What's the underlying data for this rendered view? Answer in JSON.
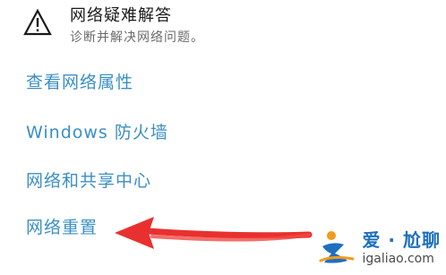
{
  "troubleshoot": {
    "title": "网络疑难解答",
    "subtitle": "诊断并解决网络问题。",
    "icon": "warning-icon"
  },
  "links": {
    "properties": "查看网络属性",
    "firewall": "Windows 防火墙",
    "sharing_center": "网络和共享中心",
    "reset": "网络重置"
  },
  "watermark": {
    "brand": "爱 · 尬聊",
    "url": "igaliao.com"
  },
  "colors": {
    "link": "#3a8fc4",
    "arrow": "#e8312f",
    "brand": "#1e6fbf"
  }
}
